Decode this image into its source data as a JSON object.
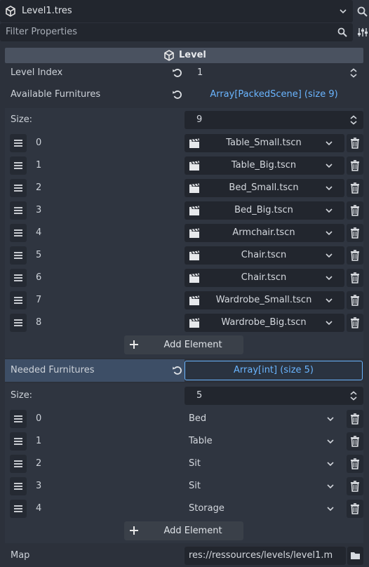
{
  "header": {
    "resource_name": "Level1.tres",
    "filter_placeholder": "Filter Properties"
  },
  "section": {
    "title": "Level"
  },
  "level_index": {
    "label": "Level Index",
    "value": "1"
  },
  "available": {
    "label": "Available Furnitures",
    "value": "Array[PackedScene] (size 9)",
    "size_label": "Size:",
    "size_value": "9",
    "items": [
      {
        "index": "0",
        "value": "Table_Small.tscn"
      },
      {
        "index": "1",
        "value": "Table_Big.tscn"
      },
      {
        "index": "2",
        "value": "Bed_Small.tscn"
      },
      {
        "index": "3",
        "value": "Bed_Big.tscn"
      },
      {
        "index": "4",
        "value": "Armchair.tscn"
      },
      {
        "index": "5",
        "value": "Chair.tscn"
      },
      {
        "index": "6",
        "value": "Chair.tscn"
      },
      {
        "index": "7",
        "value": "Wardrobe_Small.tscn"
      },
      {
        "index": "8",
        "value": "Wardrobe_Big.tscn"
      }
    ],
    "add_label": "Add Element"
  },
  "needed": {
    "label": "Needed Furnitures",
    "value": "Array[int] (size 5)",
    "size_label": "Size:",
    "size_value": "5",
    "items": [
      {
        "index": "0",
        "value": "Bed"
      },
      {
        "index": "1",
        "value": "Table"
      },
      {
        "index": "2",
        "value": "Sit"
      },
      {
        "index": "3",
        "value": "Sit"
      },
      {
        "index": "4",
        "value": "Storage"
      }
    ],
    "add_label": "Add Element"
  },
  "map": {
    "label": "Map",
    "value": "res://ressources/levels/level1.m"
  },
  "colors": {
    "accent": "#6ab5ff",
    "background": "#2c313b",
    "field": "#22262e",
    "selected_row": "#3d4e66"
  }
}
